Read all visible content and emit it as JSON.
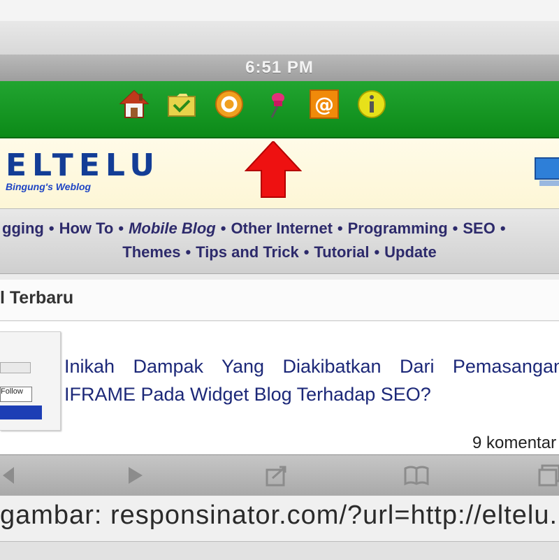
{
  "status_bar": {
    "time": "6:51 PM"
  },
  "green_toolbar": {
    "icons": [
      "home-icon",
      "folder-icon",
      "help-icon",
      "pin-icon",
      "email-icon",
      "info-icon"
    ]
  },
  "header": {
    "logo": "ELTELU",
    "subtitle": "Bingung's Weblog"
  },
  "nav": {
    "row1": [
      "gging",
      "How To",
      "Mobile Blog",
      "Other Internet",
      "Programming",
      "SEO"
    ],
    "row2": [
      "Themes",
      "Tips and Trick",
      "Tutorial",
      "Update"
    ],
    "separator": "•"
  },
  "section": {
    "title": "l Terbaru"
  },
  "article": {
    "title_line1": "Inikah Dampak Yang Diakibatkan Dari Pemasangan",
    "title_line2": "IFRAME Pada Widget Blog Terhadap SEO?",
    "comments": "9 komentar",
    "thumb_button": "Follow"
  },
  "bottom_toolbar": {
    "icons": [
      "back-icon",
      "forward-icon",
      "share-icon",
      "bookmarks-icon",
      "tabs-icon"
    ]
  },
  "caption": "gambar: responsinator.com/?url=http://eltelu.b",
  "colors": {
    "green_bar": "#14961f",
    "link_text": "#1c2878",
    "logo": "#133d96",
    "arrow": "#ee1111"
  }
}
